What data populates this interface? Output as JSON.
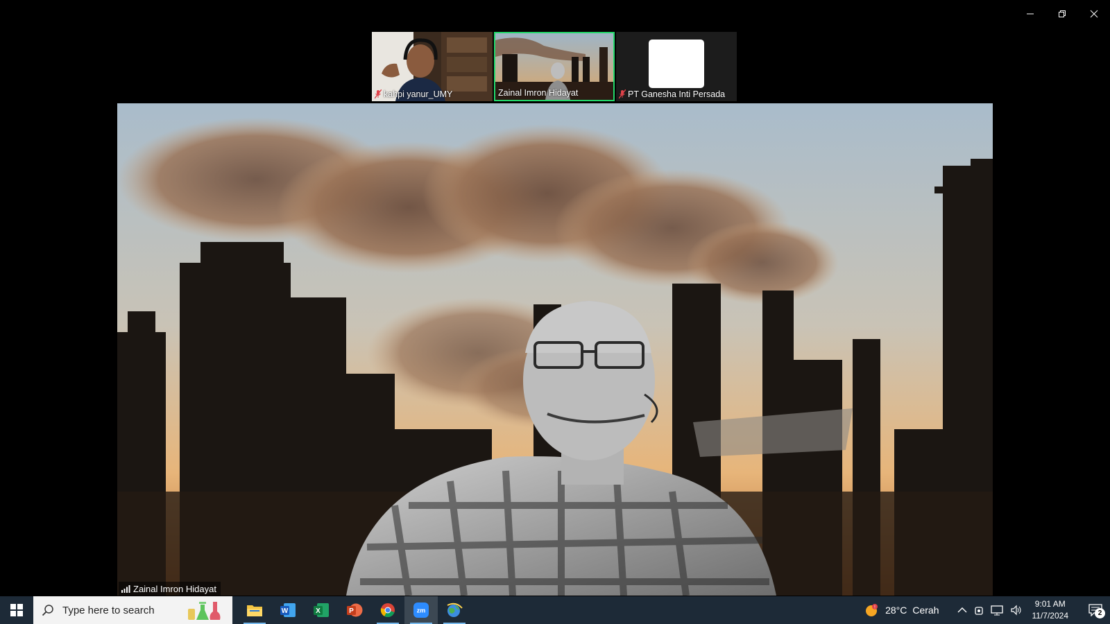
{
  "window": {
    "controls": [
      "minimize",
      "restore",
      "close"
    ]
  },
  "participants": [
    {
      "name": "kahpi yanur_UMY",
      "muted": true,
      "active": false
    },
    {
      "name": "Zainal Imron Hidayat",
      "muted": false,
      "active": true
    },
    {
      "name": "PT Ganesha Inti Persada",
      "muted": true,
      "active": false
    }
  ],
  "main_video": {
    "speaker_name": "Zainal Imron Hidayat",
    "signal_icon": "signal-bars-icon"
  },
  "taskbar": {
    "search_placeholder": "Type here to search",
    "apps": [
      {
        "name": "File Explorer",
        "icon": "folder-icon",
        "running": true
      },
      {
        "name": "Word",
        "icon": "word-icon",
        "running": false
      },
      {
        "name": "Excel",
        "icon": "excel-icon",
        "running": false
      },
      {
        "name": "PowerPoint",
        "icon": "powerpoint-icon",
        "running": false
      },
      {
        "name": "Chrome",
        "icon": "chrome-icon",
        "running": true
      },
      {
        "name": "Zoom",
        "icon": "zoom-icon",
        "running": true,
        "label": "zm"
      },
      {
        "name": "Maps",
        "icon": "globe-icon",
        "running": true
      }
    ],
    "weather": {
      "temp": "28°C",
      "condition": "Cerah"
    },
    "clock": {
      "time": "9:01 AM",
      "date": "11/7/2024"
    },
    "notifications": "2"
  },
  "colors": {
    "active_border": "#23d96b",
    "taskbar_bg": "#1d2a37",
    "muted_mic": "#e0424a",
    "zoom_blue": "#2d8cff"
  }
}
